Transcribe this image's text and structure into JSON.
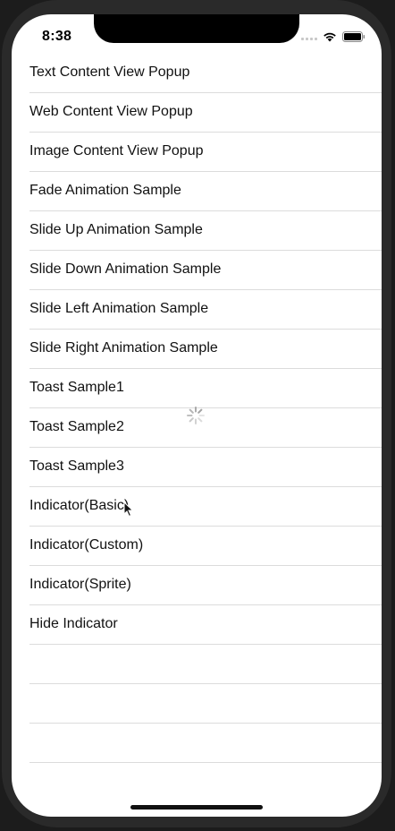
{
  "status_bar": {
    "time": "8:38"
  },
  "list": {
    "items": [
      {
        "label": "Text Content View Popup"
      },
      {
        "label": "Web Content View Popup"
      },
      {
        "label": "Image Content View Popup"
      },
      {
        "label": "Fade Animation Sample"
      },
      {
        "label": "Slide Up Animation Sample"
      },
      {
        "label": "Slide Down Animation Sample"
      },
      {
        "label": "Slide Left Animation Sample"
      },
      {
        "label": "Slide Right Animation Sample"
      },
      {
        "label": "Toast Sample1"
      },
      {
        "label": "Toast Sample2"
      },
      {
        "label": "Toast Sample3"
      },
      {
        "label": "Indicator(Basic)"
      },
      {
        "label": "Indicator(Custom)"
      },
      {
        "label": "Indicator(Sprite)"
      },
      {
        "label": "Hide Indicator"
      },
      {
        "label": ""
      },
      {
        "label": ""
      },
      {
        "label": ""
      }
    ]
  },
  "colors": {
    "background": "#ffffff",
    "separator": "#dcdcdc",
    "text": "#111111"
  }
}
